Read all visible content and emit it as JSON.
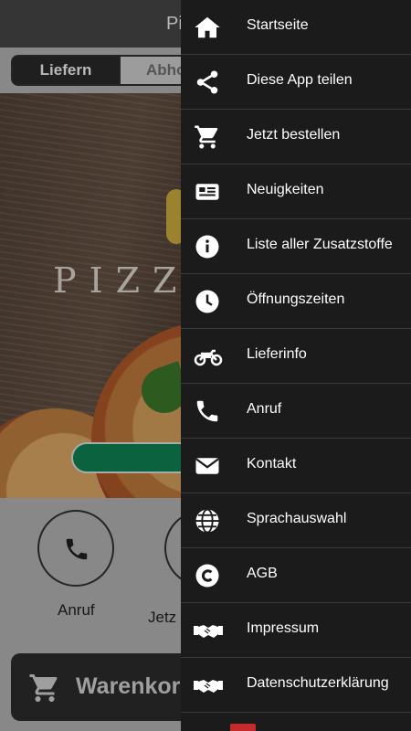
{
  "app": {
    "title": "Pi",
    "tabs": [
      {
        "label": "Liefern",
        "active": true
      },
      {
        "label": "Abho",
        "active": false
      }
    ],
    "hero_text": "PIZZ",
    "quick_actions": [
      {
        "label": "Anruf",
        "icon": "phone-icon"
      },
      {
        "label": "Jetz",
        "icon": "cart-icon"
      }
    ],
    "cart_label": "Warenkorl"
  },
  "drawer": {
    "items": [
      {
        "label": "Startseite",
        "icon": "home-icon"
      },
      {
        "label": "Diese App teilen",
        "icon": "share-icon"
      },
      {
        "label": "Jetzt bestellen",
        "icon": "cart-icon"
      },
      {
        "label": "Neuigkeiten",
        "icon": "newspaper-icon"
      },
      {
        "label": "Liste aller Zusatzstoffe",
        "icon": "info-icon"
      },
      {
        "label": "Öffnungszeiten",
        "icon": "clock-icon"
      },
      {
        "label": "Lieferinfo",
        "icon": "motorcycle-icon"
      },
      {
        "label": "Anruf",
        "icon": "phone-icon"
      },
      {
        "label": "Kontakt",
        "icon": "envelope-icon"
      },
      {
        "label": "Sprachauswahl",
        "icon": "globe-icon"
      },
      {
        "label": "AGB",
        "icon": "copyright-icon"
      },
      {
        "label": "Impressum",
        "icon": "handshake-icon"
      },
      {
        "label": "Datenschutzerklärung",
        "icon": "handshake-icon"
      }
    ]
  },
  "colors": {
    "topbar": "#4a4a4a",
    "drawer_bg": "#1b1b1b",
    "accent_green": "#0f8a56",
    "tab_active": "#2b2b2b"
  }
}
